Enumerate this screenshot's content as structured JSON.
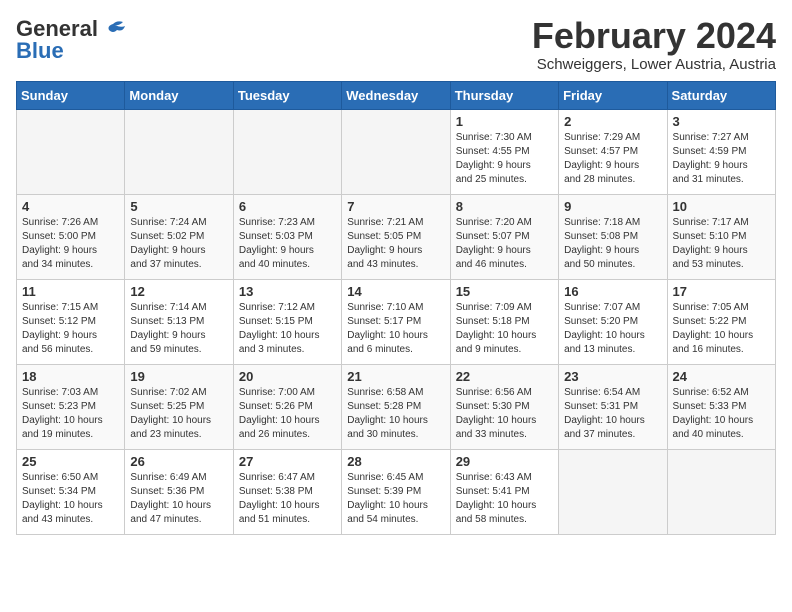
{
  "header": {
    "logo_general": "General",
    "logo_blue": "Blue",
    "month": "February 2024",
    "location": "Schweiggers, Lower Austria, Austria"
  },
  "weekdays": [
    "Sunday",
    "Monday",
    "Tuesday",
    "Wednesday",
    "Thursday",
    "Friday",
    "Saturday"
  ],
  "weeks": [
    [
      {
        "day": "",
        "info": ""
      },
      {
        "day": "",
        "info": ""
      },
      {
        "day": "",
        "info": ""
      },
      {
        "day": "",
        "info": ""
      },
      {
        "day": "1",
        "info": "Sunrise: 7:30 AM\nSunset: 4:55 PM\nDaylight: 9 hours\nand 25 minutes."
      },
      {
        "day": "2",
        "info": "Sunrise: 7:29 AM\nSunset: 4:57 PM\nDaylight: 9 hours\nand 28 minutes."
      },
      {
        "day": "3",
        "info": "Sunrise: 7:27 AM\nSunset: 4:59 PM\nDaylight: 9 hours\nand 31 minutes."
      }
    ],
    [
      {
        "day": "4",
        "info": "Sunrise: 7:26 AM\nSunset: 5:00 PM\nDaylight: 9 hours\nand 34 minutes."
      },
      {
        "day": "5",
        "info": "Sunrise: 7:24 AM\nSunset: 5:02 PM\nDaylight: 9 hours\nand 37 minutes."
      },
      {
        "day": "6",
        "info": "Sunrise: 7:23 AM\nSunset: 5:03 PM\nDaylight: 9 hours\nand 40 minutes."
      },
      {
        "day": "7",
        "info": "Sunrise: 7:21 AM\nSunset: 5:05 PM\nDaylight: 9 hours\nand 43 minutes."
      },
      {
        "day": "8",
        "info": "Sunrise: 7:20 AM\nSunset: 5:07 PM\nDaylight: 9 hours\nand 46 minutes."
      },
      {
        "day": "9",
        "info": "Sunrise: 7:18 AM\nSunset: 5:08 PM\nDaylight: 9 hours\nand 50 minutes."
      },
      {
        "day": "10",
        "info": "Sunrise: 7:17 AM\nSunset: 5:10 PM\nDaylight: 9 hours\nand 53 minutes."
      }
    ],
    [
      {
        "day": "11",
        "info": "Sunrise: 7:15 AM\nSunset: 5:12 PM\nDaylight: 9 hours\nand 56 minutes."
      },
      {
        "day": "12",
        "info": "Sunrise: 7:14 AM\nSunset: 5:13 PM\nDaylight: 9 hours\nand 59 minutes."
      },
      {
        "day": "13",
        "info": "Sunrise: 7:12 AM\nSunset: 5:15 PM\nDaylight: 10 hours\nand 3 minutes."
      },
      {
        "day": "14",
        "info": "Sunrise: 7:10 AM\nSunset: 5:17 PM\nDaylight: 10 hours\nand 6 minutes."
      },
      {
        "day": "15",
        "info": "Sunrise: 7:09 AM\nSunset: 5:18 PM\nDaylight: 10 hours\nand 9 minutes."
      },
      {
        "day": "16",
        "info": "Sunrise: 7:07 AM\nSunset: 5:20 PM\nDaylight: 10 hours\nand 13 minutes."
      },
      {
        "day": "17",
        "info": "Sunrise: 7:05 AM\nSunset: 5:22 PM\nDaylight: 10 hours\nand 16 minutes."
      }
    ],
    [
      {
        "day": "18",
        "info": "Sunrise: 7:03 AM\nSunset: 5:23 PM\nDaylight: 10 hours\nand 19 minutes."
      },
      {
        "day": "19",
        "info": "Sunrise: 7:02 AM\nSunset: 5:25 PM\nDaylight: 10 hours\nand 23 minutes."
      },
      {
        "day": "20",
        "info": "Sunrise: 7:00 AM\nSunset: 5:26 PM\nDaylight: 10 hours\nand 26 minutes."
      },
      {
        "day": "21",
        "info": "Sunrise: 6:58 AM\nSunset: 5:28 PM\nDaylight: 10 hours\nand 30 minutes."
      },
      {
        "day": "22",
        "info": "Sunrise: 6:56 AM\nSunset: 5:30 PM\nDaylight: 10 hours\nand 33 minutes."
      },
      {
        "day": "23",
        "info": "Sunrise: 6:54 AM\nSunset: 5:31 PM\nDaylight: 10 hours\nand 37 minutes."
      },
      {
        "day": "24",
        "info": "Sunrise: 6:52 AM\nSunset: 5:33 PM\nDaylight: 10 hours\nand 40 minutes."
      }
    ],
    [
      {
        "day": "25",
        "info": "Sunrise: 6:50 AM\nSunset: 5:34 PM\nDaylight: 10 hours\nand 43 minutes."
      },
      {
        "day": "26",
        "info": "Sunrise: 6:49 AM\nSunset: 5:36 PM\nDaylight: 10 hours\nand 47 minutes."
      },
      {
        "day": "27",
        "info": "Sunrise: 6:47 AM\nSunset: 5:38 PM\nDaylight: 10 hours\nand 51 minutes."
      },
      {
        "day": "28",
        "info": "Sunrise: 6:45 AM\nSunset: 5:39 PM\nDaylight: 10 hours\nand 54 minutes."
      },
      {
        "day": "29",
        "info": "Sunrise: 6:43 AM\nSunset: 5:41 PM\nDaylight: 10 hours\nand 58 minutes."
      },
      {
        "day": "",
        "info": ""
      },
      {
        "day": "",
        "info": ""
      }
    ]
  ]
}
